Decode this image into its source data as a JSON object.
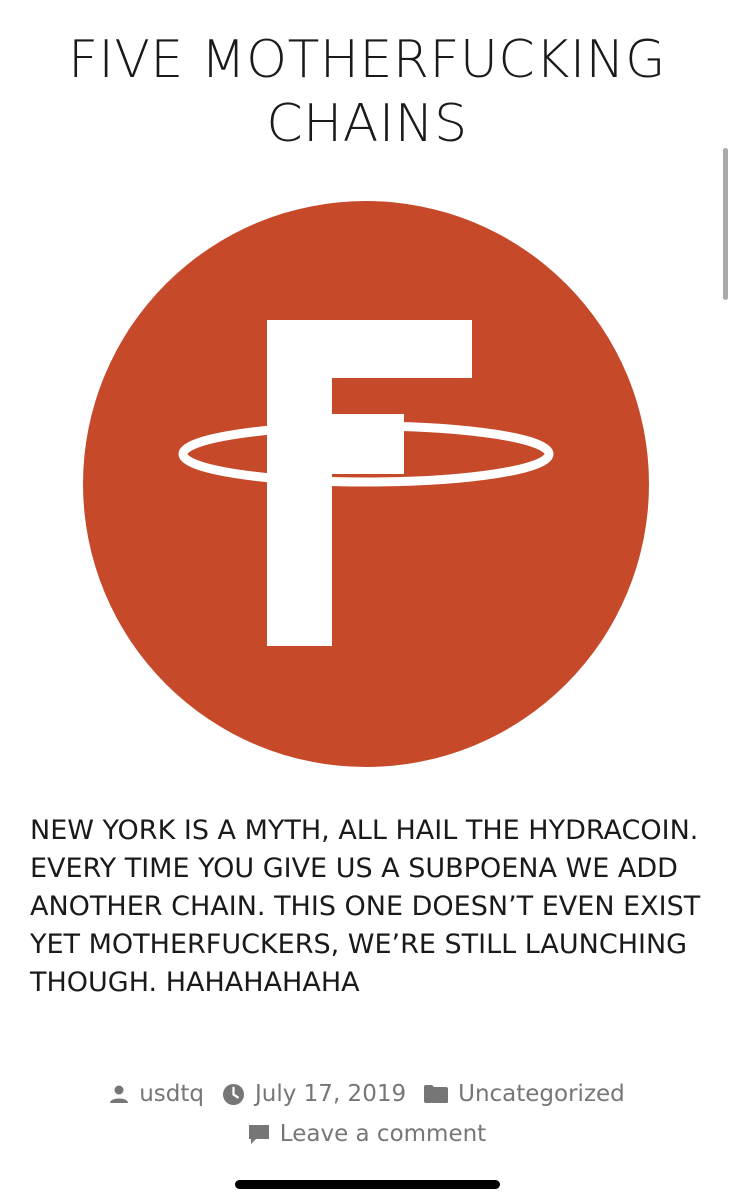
{
  "post": {
    "title": "FIVE MOTHERFUCKING CHAINS",
    "body": "NEW YORK IS A MYTH, ALL HAIL THE HYDRACOIN. EVERY TIME YOU GIVE US A SUBPOENA WE ADD ANOTHER CHAIN. THIS ONE DOESN’T EVEN EXIST YET MOTHERFUCKERS, WE’RE STILL LAUNCHING THOUGH. HAHAHAHAHA",
    "logo": {
      "letter": "F",
      "color": "#c6492a",
      "icon": "ringed-f-logo"
    }
  },
  "meta": {
    "author": "usdtq",
    "date": "July 17, 2019",
    "category": "Uncategorized",
    "comment_link": "Leave a comment",
    "icons": [
      "person-icon",
      "clock-icon",
      "folder-icon",
      "comment-icon"
    ],
    "text_color": "#767676"
  }
}
